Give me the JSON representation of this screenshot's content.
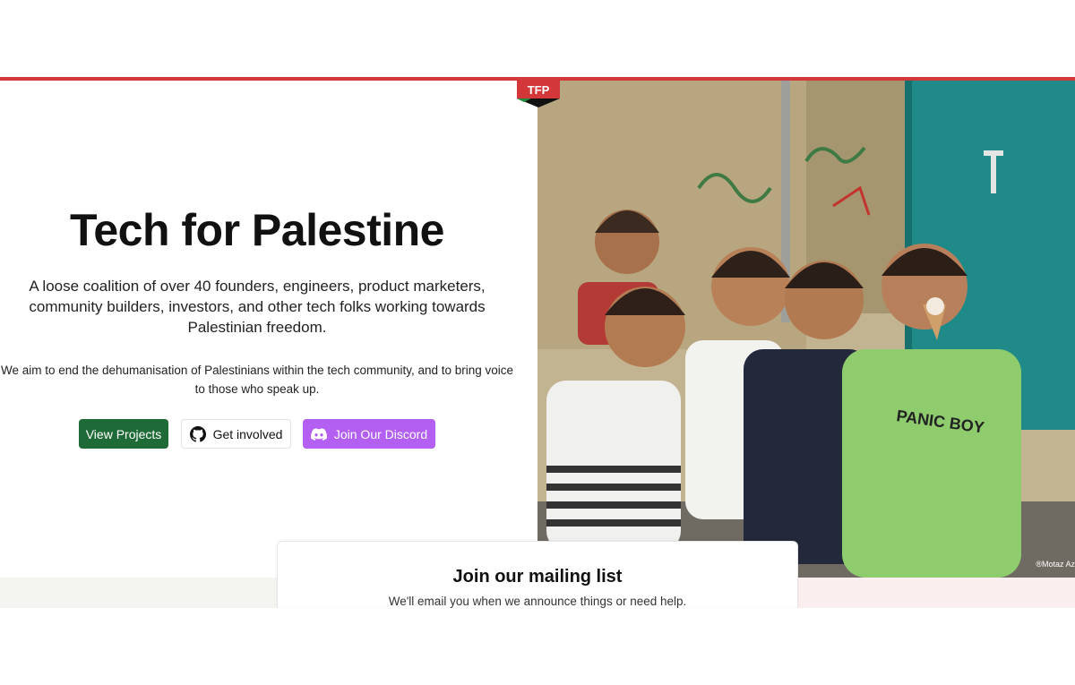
{
  "brand": {
    "logo_text": "TFP",
    "accent": "#d3373a"
  },
  "hero": {
    "title": "Tech for Palestine",
    "lead": "A loose coalition of over 40 founders, engineers, product marketers, community builders, investors, and other tech folks working towards Palestinian freedom.",
    "aim": "We aim to end the dehumanisation of Palestinians within the tech community, and to bring voice to those who speak up."
  },
  "buttons": {
    "projects": "View Projects",
    "involved": "Get involved",
    "discord": "Join Our Discord"
  },
  "icons": {
    "involved": "github-icon",
    "discord": "discord-icon"
  },
  "colors": {
    "projects": "#1f6b38",
    "discord": "#b25ff2"
  },
  "photo": {
    "credit": "®Motaz Az"
  },
  "mailing": {
    "title": "Join our mailing list",
    "subtitle": "We'll email you when we announce things or need help."
  }
}
